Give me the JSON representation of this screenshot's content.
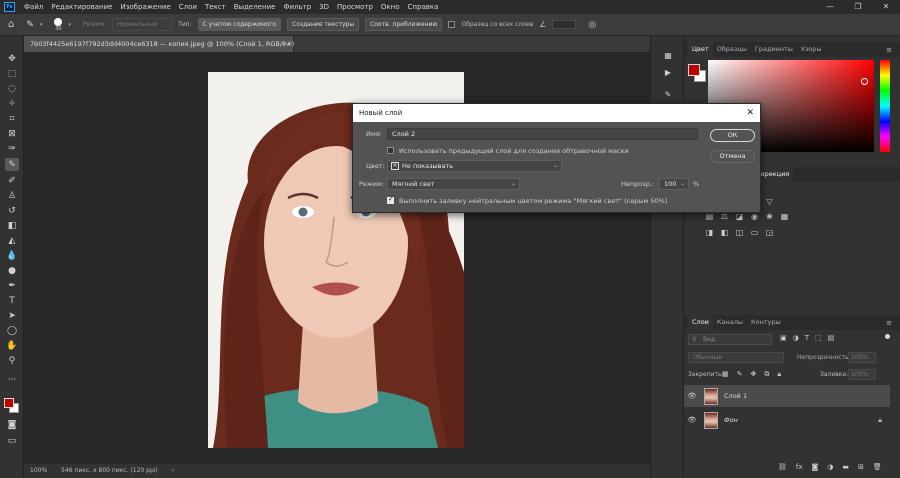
{
  "menubar": {
    "app_icon": "Ps",
    "items": [
      "Файл",
      "Редактирование",
      "Изображение",
      "Слои",
      "Текст",
      "Выделение",
      "Фильтр",
      "3D",
      "Просмотр",
      "Окно",
      "Справка"
    ],
    "window_controls": [
      "—",
      "❐",
      "✕"
    ]
  },
  "optionsbar": {
    "brush_size": "30",
    "mode_label": "Режим:",
    "mode_value": "Нормальный",
    "type_label": "Тип:",
    "btn_content_aware": "С учетом содержимого",
    "btn_create_texture": "Создание текстуры",
    "btn_proximity": "Соотв. приближению",
    "sample_all_layers": "Образец со всех слоев"
  },
  "document": {
    "tab_title": "7b03f4425e6197f792d3dd4004ce6318 — копия.jpeg @ 100% (Слой 1, RGB/8#) *",
    "zoom": "100%",
    "size_info": "546 пикс. x 800 пикс. (120 ppi)"
  },
  "panels": {
    "color_tabs": [
      "Цвет",
      "Образцы",
      "Градиенты",
      "Узоры"
    ],
    "props_tabs": [
      "Корекция"
    ],
    "layers_tabs": [
      "Слои",
      "Каналы",
      "Контуры"
    ],
    "layers_search": "Вид",
    "blend_mode": "Обычные",
    "opacity_label": "Непрозрачность:",
    "opacity_value": "100%",
    "lock_label": "Закрепить:",
    "fill_label": "Заливка:",
    "fill_value": "100%",
    "layers": [
      {
        "name": "Слой 1",
        "selected": true,
        "locked": false
      },
      {
        "name": "Фон",
        "selected": false,
        "locked": true
      }
    ],
    "colors": {
      "foreground": "#c00000",
      "background": "#ffffff"
    }
  },
  "dialog": {
    "title": "Новый слой",
    "name_label": "Имя:",
    "name_value": "Слой 2",
    "clip_mask_label": "Использовать предыдущий слой для создания обтравочной маски",
    "color_label": "Цвет:",
    "color_value": "Не показывать",
    "mode_label": "Режим:",
    "mode_value": "Мягкий свет",
    "opacity_label": "Непрозр.:",
    "opacity_value": "100",
    "opacity_unit": "%",
    "fill_neutral_label": "Выполнить заливку нейтральным цветом режима \"Мягкий свет\" (серым 50%)",
    "ok_label": "ОК",
    "cancel_label": "Отмена"
  }
}
